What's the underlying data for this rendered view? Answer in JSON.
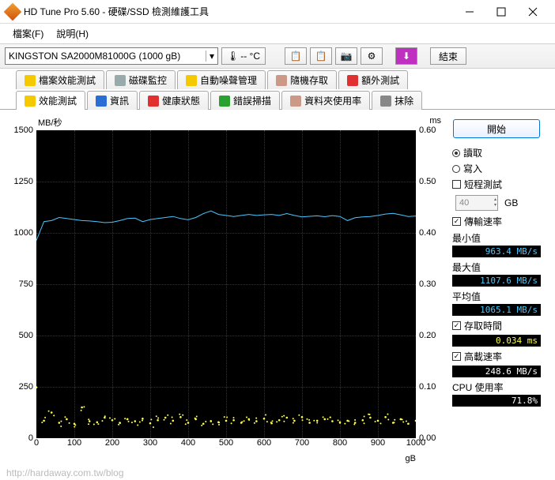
{
  "window": {
    "title": "HD Tune Pro 5.60 - 硬碟/SSD 檢測維護工具"
  },
  "menu": {
    "file": "檔案(F)",
    "help": "說明(H)"
  },
  "toolbar": {
    "drive": "KINGSTON SA2000M81000G (1000 gB)",
    "temp": "-- °C",
    "exit": "結束"
  },
  "tabs_row1": [
    {
      "label": "檔案效能測試",
      "icon_color": "#f5c900"
    },
    {
      "label": "磁碟監控",
      "icon_color": "#9aa"
    },
    {
      "label": "自動噪聲管理",
      "icon_color": "#f5c900"
    },
    {
      "label": "隨機存取",
      "icon_color": "#c98"
    },
    {
      "label": "額外測試",
      "icon_color": "#e03030"
    }
  ],
  "tabs_row2": [
    {
      "label": "效能測試",
      "icon_color": "#f5c900",
      "active": true
    },
    {
      "label": "資訊",
      "icon_color": "#2a6dd4"
    },
    {
      "label": "健康狀態",
      "icon_color": "#e03030"
    },
    {
      "label": "錯誤掃描",
      "icon_color": "#2aa030"
    },
    {
      "label": "資料夾使用率",
      "icon_color": "#c98"
    },
    {
      "label": "抹除",
      "icon_color": "#888"
    }
  ],
  "chart": {
    "y_left_label": "MB/秒",
    "y_right_label": "ms",
    "x_unit": "gB"
  },
  "chart_data": {
    "type": "line",
    "y_left": {
      "label": "MB/秒",
      "min": 0,
      "max": 1500,
      "ticks": [
        0,
        250,
        500,
        750,
        1000,
        1250,
        1500
      ]
    },
    "y_right": {
      "label": "ms",
      "min": 0,
      "max": 0.6,
      "ticks": [
        0.0,
        0.1,
        0.2,
        0.3,
        0.4,
        0.5,
        0.6
      ]
    },
    "x": {
      "label": "gB",
      "min": 0,
      "max": 1000,
      "ticks": [
        0,
        100,
        200,
        300,
        400,
        500,
        600,
        700,
        800,
        900,
        1000
      ]
    },
    "series": [
      {
        "name": "傳輸速率",
        "color": "#49c8ff",
        "axis": "left",
        "values": [
          963,
          1055,
          1060,
          1075,
          1070,
          1065,
          1060,
          1058,
          1055,
          1050,
          1052,
          1060,
          1070,
          1072,
          1055,
          1065,
          1070,
          1075,
          1080,
          1070,
          1064,
          1075,
          1094,
          1107,
          1090,
          1085,
          1080,
          1085,
          1090,
          1085,
          1088,
          1090,
          1085,
          1094,
          1085,
          1078,
          1081,
          1083,
          1079,
          1084,
          1080,
          1060,
          1074,
          1078,
          1080,
          1085,
          1092,
          1095,
          1088,
          1080,
          1082
        ]
      },
      {
        "name": "存取時間",
        "color": "#ffff4d",
        "axis": "right",
        "values": [
          0.099,
          0.034,
          0.05,
          0.03,
          0.037,
          0.028,
          0.06,
          0.033,
          0.031,
          0.04,
          0.035,
          0.03,
          0.037,
          0.033,
          0.038,
          0.029,
          0.035,
          0.04,
          0.034,
          0.041,
          0.03,
          0.037,
          0.028,
          0.033,
          0.031,
          0.034,
          0.035,
          0.03,
          0.037,
          0.033,
          0.038,
          0.029,
          0.035,
          0.04,
          0.034,
          0.041,
          0.03,
          0.034,
          0.037,
          0.033,
          0.031,
          0.034,
          0.03,
          0.035,
          0.04,
          0.034,
          0.041,
          0.03,
          0.037,
          0.028,
          0.034
        ]
      }
    ]
  },
  "panel": {
    "start": "開始",
    "read": "讀取",
    "write": "寫入",
    "short_test": "短程測試",
    "short_value": "40",
    "gb_unit": "GB",
    "transfer_rate": "傳輸速率",
    "min_label": "最小值",
    "min_value": "963.4 MB/s",
    "max_label": "最大值",
    "max_value": "1107.6 MB/s",
    "avg_label": "平均值",
    "avg_value": "1065.1 MB/s",
    "access_time": "存取時間",
    "access_value": "0.034 ms",
    "burst_rate": "高載速率",
    "burst_value": "248.6 MB/s",
    "cpu_label": "CPU 使用率",
    "cpu_value": "71.8%"
  },
  "watermark": "http://hardaway.com.tw/blog"
}
